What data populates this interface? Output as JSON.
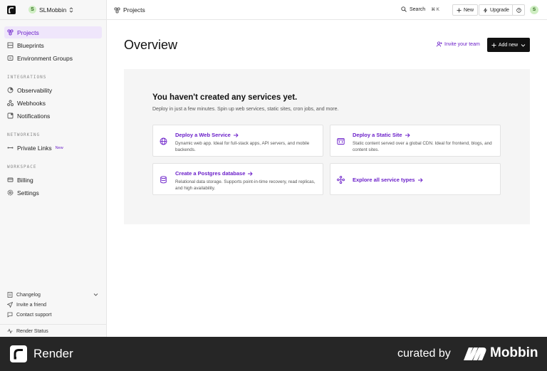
{
  "sidebar": {
    "workspace": {
      "avatar": "S",
      "name": "SLMobbin"
    },
    "items": [
      {
        "label": "Projects",
        "icon": "projects-icon"
      },
      {
        "label": "Blueprints",
        "icon": "blueprints-icon"
      },
      {
        "label": "Environment Groups",
        "icon": "environment-groups-icon"
      }
    ],
    "sections": {
      "integrations": {
        "title": "INTEGRATIONS",
        "items": [
          {
            "label": "Observability",
            "icon": "observability-icon"
          },
          {
            "label": "Webhooks",
            "icon": "webhooks-icon"
          },
          {
            "label": "Notifications",
            "icon": "notifications-icon"
          }
        ]
      },
      "networking": {
        "title": "NETWORKING",
        "items": [
          {
            "label": "Private Links",
            "badge": "New",
            "icon": "private-links-icon"
          }
        ]
      },
      "workspace": {
        "title": "WORKSPACE",
        "items": [
          {
            "label": "Billing",
            "icon": "billing-icon"
          },
          {
            "label": "Settings",
            "icon": "settings-icon"
          }
        ]
      }
    },
    "footer": {
      "changelog": "Changelog",
      "invite": "Invite a friend",
      "support": "Contact support",
      "status": "Render Status"
    }
  },
  "topbar": {
    "breadcrumb": "Projects",
    "search_label": "Search",
    "search_shortcut": "⌘ K",
    "new_label": "New",
    "upgrade_label": "Upgrade",
    "user_avatar": "S"
  },
  "main": {
    "title": "Overview",
    "invite_team": "Invite your team",
    "add_new": "Add new",
    "empty": {
      "title": "You haven't created any services yet.",
      "subtitle": "Deploy in just a few minutes. Spin up web services, static sites, cron jobs, and more.",
      "cards": [
        {
          "title": "Deploy a Web Service",
          "desc": "Dynamic web app. Ideal for full-stack apps, API servers, and mobile backends.",
          "icon": "globe-icon"
        },
        {
          "title": "Deploy a Static Site",
          "desc": "Static content served over a global CDN. Ideal for frontend, blogs, and content sites.",
          "icon": "code-window-icon"
        },
        {
          "title": "Create a Postgres database",
          "desc": "Relational data storage. Supports point-in-time recovery, read replicas, and high availability.",
          "icon": "database-icon"
        },
        {
          "title": "Explore all service types",
          "desc": "",
          "icon": "nodes-icon"
        }
      ]
    }
  },
  "brandbar": {
    "app_name": "Render",
    "curated_by": "curated by",
    "curator": "Mobbin"
  },
  "colors": {
    "accent": "#6b1fc9",
    "active_bg": "#efe6fb",
    "brand_bar": "#262626"
  }
}
